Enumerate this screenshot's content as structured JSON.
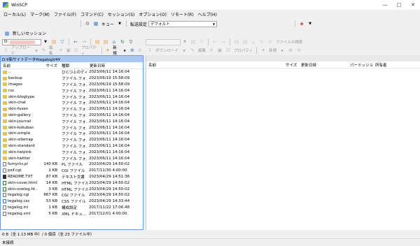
{
  "window": {
    "title": "WinSCP"
  },
  "menu": [
    "ローカル(L)",
    "マーク(M)",
    "ファイル(F)",
    "コマンド(C)",
    "セッション(S)",
    "オプション(O)",
    "リモート(R)",
    "ヘルプ(H)"
  ],
  "toolbar": {
    "queue_label": "キュー",
    "transfer_settings_label": "転送設定",
    "transfer_settings_value": "デフォルト"
  },
  "session": {
    "new_session_label": "新しいセッション"
  },
  "local_nav": {
    "drive": "D:"
  },
  "local_actions": {
    "upload": "アップロード",
    "edit": "編集",
    "properties": "プロパティ",
    "new": "新規"
  },
  "remote_nav": {
    "find_files": "ファイルの検索"
  },
  "remote_actions": {
    "download": "ダウンロード",
    "edit": "編集",
    "properties": "プロパティ",
    "new": "新規"
  },
  "local_panel": {
    "path": "D:¥新サイトデータ¥tegalogV4¥",
    "columns": {
      "name": "名前",
      "size": "サイズ",
      "type": "種類",
      "modified": "更新日時"
    },
    "files": [
      {
        "name": "..",
        "size": "",
        "type": "ひとつ上のディ...",
        "date": "2023/06/11 14:16:04",
        "icon": "up"
      },
      {
        "name": "backup",
        "size": "",
        "type": "ファイル フォ...",
        "date": "2023/06/19 15:58:09",
        "icon": "folder"
      },
      {
        "name": "images",
        "size": "",
        "type": "ファイル フォ...",
        "date": "2023/06/19 15:58:09",
        "icon": "folder"
      },
      {
        "name": "rss",
        "size": "",
        "type": "ファイル フォ...",
        "date": "2023/06/11 14:16:04",
        "icon": "folder"
      },
      {
        "name": "skin-blogtype",
        "size": "",
        "type": "ファイル フォ...",
        "date": "2023/06/11 14:16:04",
        "icon": "folder"
      },
      {
        "name": "skin-chat",
        "size": "",
        "type": "ファイル フォ...",
        "date": "2023/06/11 14:16:04",
        "icon": "folder"
      },
      {
        "name": "skin-fusen",
        "size": "",
        "type": "ファイル フォ...",
        "date": "2023/06/11 14:16:04",
        "icon": "folder"
      },
      {
        "name": "skin-gallery",
        "size": "",
        "type": "ファイル フォ...",
        "date": "2023/06/11 14:16:04",
        "icon": "folder"
      },
      {
        "name": "skin-journal",
        "size": "",
        "type": "ファイル フォ...",
        "date": "2023/06/11 14:16:04",
        "icon": "folder"
      },
      {
        "name": "skin-kokuban",
        "size": "",
        "type": "ファイル フォ...",
        "date": "2023/06/11 14:16:04",
        "icon": "folder"
      },
      {
        "name": "skin-simple",
        "size": "",
        "type": "ファイル フォ...",
        "date": "2023/06/11 14:16:04",
        "icon": "folder"
      },
      {
        "name": "skin-sitemap",
        "size": "",
        "type": "ファイル フォ...",
        "date": "2023/06/11 14:16:04",
        "icon": "folder"
      },
      {
        "name": "skin-standard",
        "size": "",
        "type": "ファイル フォ...",
        "date": "2023/06/11 14:16:04",
        "icon": "folder"
      },
      {
        "name": "skin-twipink",
        "size": "",
        "type": "ファイル フォ...",
        "date": "2023/06/11 14:16:04",
        "icon": "folder"
      },
      {
        "name": "skin-twitter",
        "size": "",
        "type": "ファイル フォ...",
        "date": "2023/06/11 14:16:04",
        "icon": "folder"
      },
      {
        "name": "fumycts.pl",
        "size": "140 KB",
        "type": "PL ファイル",
        "date": "2023/04/29 14:50:02",
        "icon": "doc"
      },
      {
        "name": "psif.cgi",
        "size": "1 KB",
        "type": "CGI ファイル",
        "date": "2017/11/30 4:00:00",
        "icon": "doc"
      },
      {
        "name": "README.TXT",
        "size": "87 KB",
        "type": "テキスト文書",
        "date": "2023/04/29 14:51:36",
        "icon": "doc txt"
      },
      {
        "name": "skin-cover.html",
        "size": "14 KB",
        "type": "HTML ファイル",
        "date": "2023/04/29 14:50:02",
        "icon": "doc html"
      },
      {
        "name": "skin-onelog.ht...",
        "size": "3 KB",
        "type": "HTML ファイル",
        "date": "2023/04/29 14:50:02",
        "icon": "doc html"
      },
      {
        "name": "tegalog.cgi",
        "size": "867 KB",
        "type": "CGI ファイル",
        "date": "2023/04/29 14:50:02",
        "icon": "doc"
      },
      {
        "name": "tegalog.css",
        "size": "53 KB",
        "type": "CSS ファイル",
        "date": "2023/04/29 14:33:44",
        "icon": "doc css"
      },
      {
        "name": "tegalog.ini",
        "size": "1 KB",
        "type": "構成設定",
        "date": "2017/11/22 17:06:48",
        "icon": "doc"
      },
      {
        "name": "tegalog.xml",
        "size": "5 KB",
        "type": "XML ドキュ...",
        "date": "2017/12/01 4:00:00",
        "icon": "doc"
      }
    ]
  },
  "remote_panel": {
    "columns": {
      "name": "名前",
      "size": "サイズ",
      "modified": "更新日時",
      "permissions": "パーミッション",
      "owner": "所有者"
    }
  },
  "status": {
    "text": "0 B（全 1.13 MB 中）/ 0 個目（全 23 ファイル中）"
  },
  "connection": {
    "text": "未接続"
  }
}
